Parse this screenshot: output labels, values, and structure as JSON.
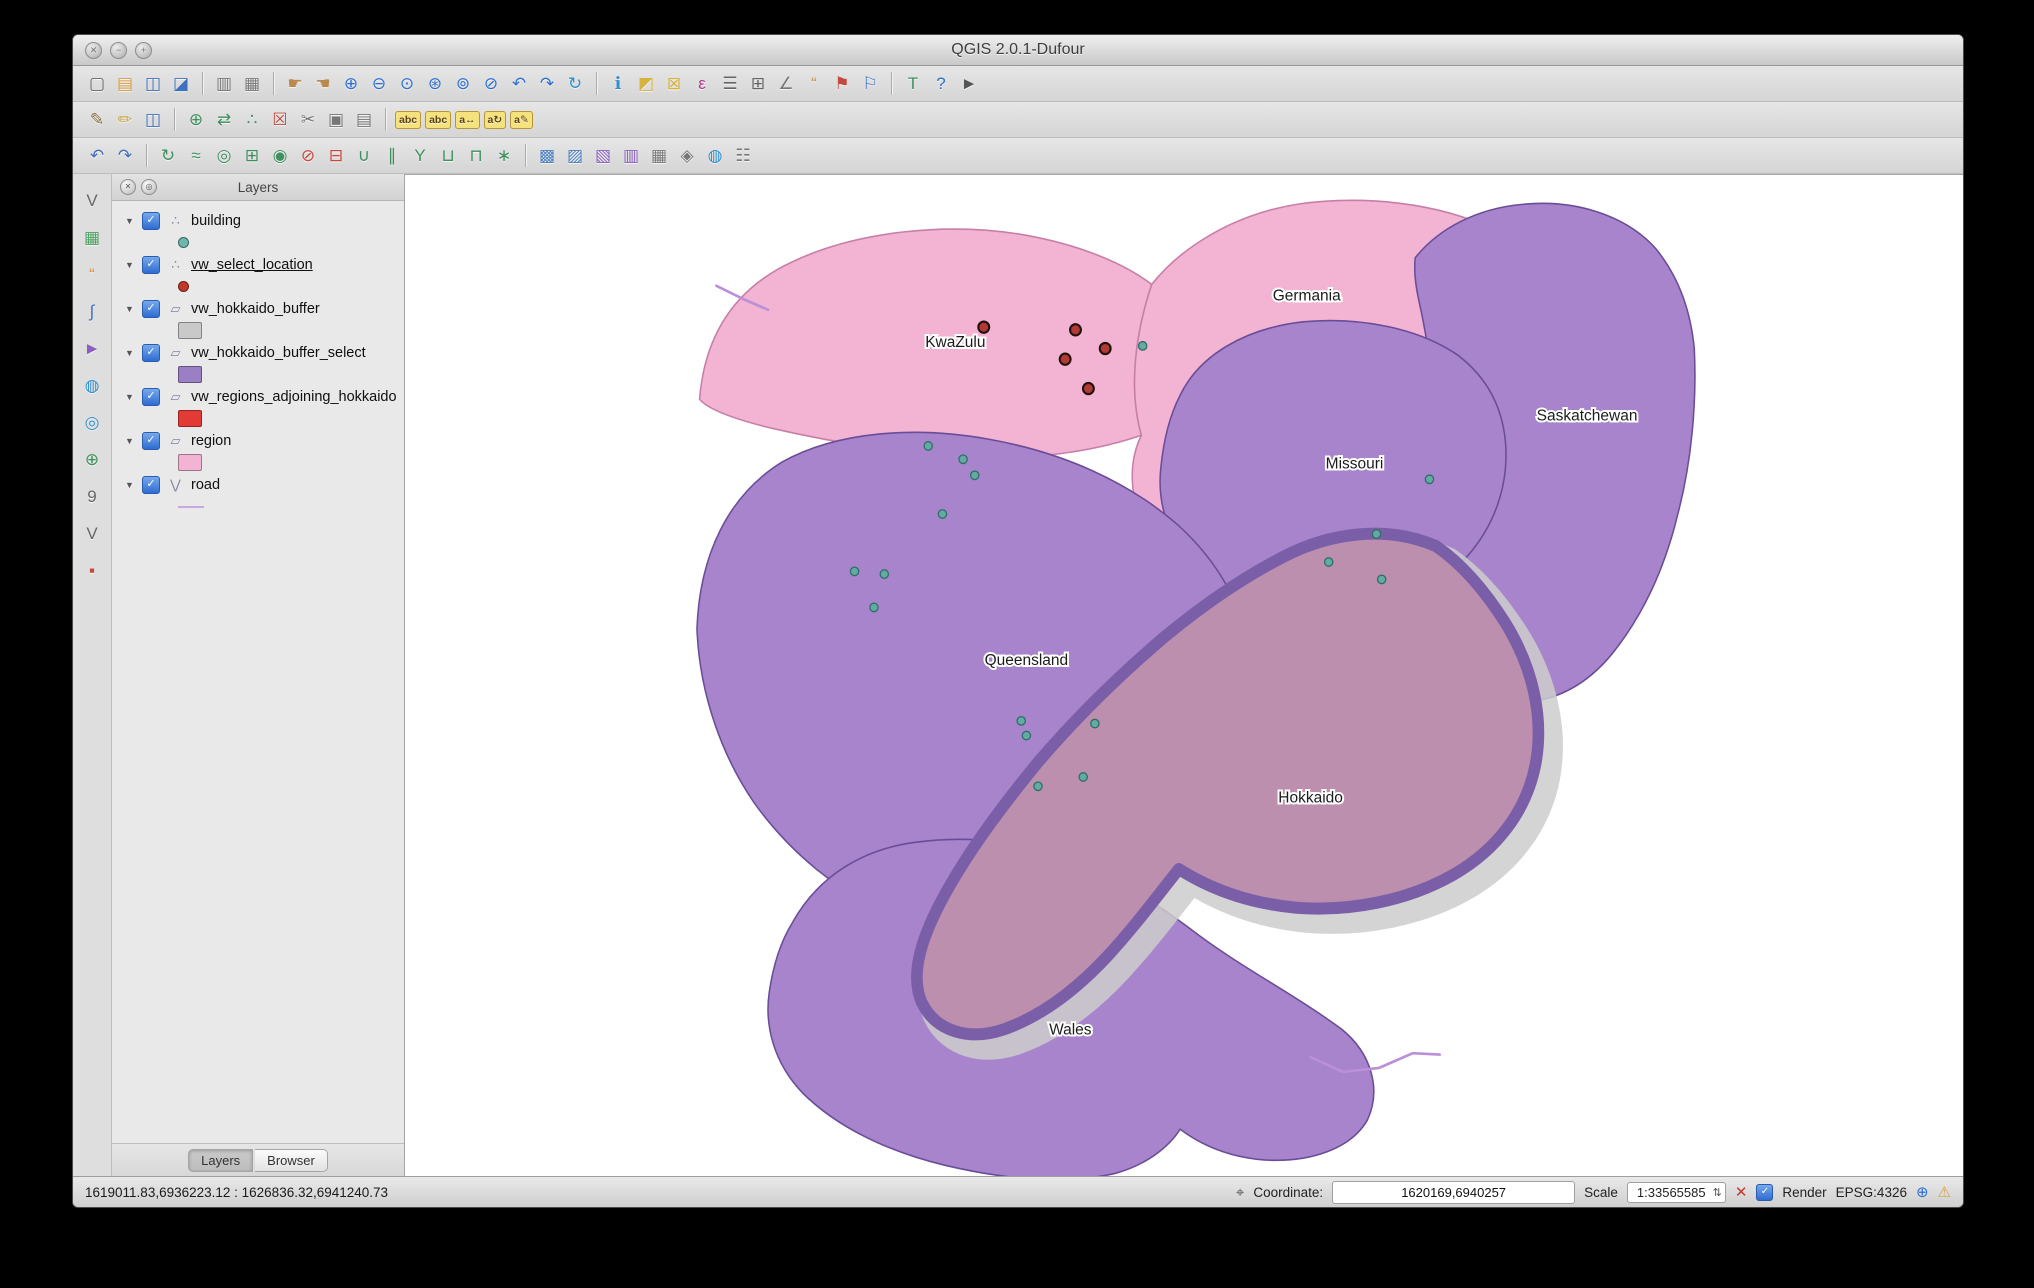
{
  "window": {
    "title": "QGIS 2.0.1-Dufour",
    "traffic": [
      "✕",
      "−",
      "+"
    ]
  },
  "glyphs": {
    "disclosure": "▼",
    "check": "✓",
    "combo_arrows": "⇅"
  },
  "toolbar_row1": [
    {
      "name": "new-project-icon",
      "glyph": "▢",
      "tint": "#666666"
    },
    {
      "name": "open-project-icon",
      "glyph": "▤",
      "tint": "#d79b3f"
    },
    {
      "name": "save-project-icon",
      "glyph": "◫",
      "tint": "#3f6fbf"
    },
    {
      "name": "save-project-as-icon",
      "glyph": "◪",
      "tint": "#3f6fbf"
    },
    {
      "sep": true
    },
    {
      "name": "new-print-composer-icon",
      "glyph": "▥",
      "tint": "#777777"
    },
    {
      "name": "composer-manager-icon",
      "glyph": "▦",
      "tint": "#777777"
    },
    {
      "sep": true
    },
    {
      "name": "pan-map-icon",
      "glyph": "☛",
      "tint": "#b98a4f"
    },
    {
      "name": "pan-to-selection-icon",
      "glyph": "☚",
      "tint": "#b98a4f"
    },
    {
      "name": "zoom-in-icon",
      "glyph": "⊕",
      "tint": "#2f6fd0"
    },
    {
      "name": "zoom-out-icon",
      "glyph": "⊖",
      "tint": "#2f6fd0"
    },
    {
      "name": "zoom-actual-icon",
      "glyph": "⊙",
      "tint": "#2f6fd0"
    },
    {
      "name": "zoom-full-icon",
      "glyph": "⊛",
      "tint": "#2f6fd0"
    },
    {
      "name": "zoom-to-selection-icon",
      "glyph": "⊚",
      "tint": "#2f6fd0"
    },
    {
      "name": "zoom-to-layer-icon",
      "glyph": "⊘",
      "tint": "#2f6fd0"
    },
    {
      "name": "zoom-last-icon",
      "glyph": "↶",
      "tint": "#2f6fd0"
    },
    {
      "name": "zoom-next-icon",
      "glyph": "↷",
      "tint": "#2f6fd0"
    },
    {
      "name": "refresh-icon",
      "glyph": "↻",
      "tint": "#2f8fd0"
    },
    {
      "sep": true
    },
    {
      "name": "identify-icon",
      "glyph": "ℹ",
      "tint": "#2f8fd0"
    },
    {
      "name": "select-features-icon",
      "glyph": "◩",
      "tint": "#d7b23f"
    },
    {
      "name": "deselect-features-icon",
      "glyph": "⊠",
      "tint": "#d7b23f"
    },
    {
      "name": "select-by-expression-icon",
      "glyph": "ε",
      "tint": "#b03a8f"
    },
    {
      "name": "attribute-table-icon",
      "glyph": "☰",
      "tint": "#666666"
    },
    {
      "name": "field-calculator-icon",
      "glyph": "⊞",
      "tint": "#666666"
    },
    {
      "name": "measure-icon",
      "glyph": "∠",
      "tint": "#777777"
    },
    {
      "name": "map-tips-icon",
      "glyph": "“",
      "tint": "#d78a3f"
    },
    {
      "name": "new-bookmark-icon",
      "glyph": "⚑",
      "tint": "#c24a3f"
    },
    {
      "name": "show-bookmarks-icon",
      "glyph": "⚐",
      "tint": "#3f6fbf"
    },
    {
      "sep": true
    },
    {
      "name": "text-annotation-icon",
      "glyph": "T",
      "tint": "#3f8f5f"
    },
    {
      "name": "help-icon",
      "glyph": "?",
      "tint": "#2f6fd0"
    },
    {
      "name": "whats-this-icon",
      "glyph": "►",
      "tint": "#555555"
    }
  ],
  "toolbar_row2": [
    {
      "name": "current-edits-icon",
      "glyph": "✎",
      "tint": "#8a6a3f"
    },
    {
      "name": "toggle-editing-icon",
      "glyph": "✏",
      "tint": "#c9a23f"
    },
    {
      "name": "save-layer-edits-icon",
      "glyph": "◫",
      "tint": "#3f6fbf"
    },
    {
      "sep": true
    },
    {
      "name": "add-feature-icon",
      "glyph": "⊕",
      "tint": "#3f8f5f"
    },
    {
      "name": "move-feature-icon",
      "glyph": "⇄",
      "tint": "#3f8f5f"
    },
    {
      "name": "node-tool-icon",
      "glyph": "∴",
      "tint": "#3f8f5f"
    },
    {
      "name": "delete-selected-icon",
      "glyph": "☒",
      "tint": "#c24a3f"
    },
    {
      "name": "cut-features-icon",
      "glyph": "✂",
      "tint": "#777777"
    },
    {
      "name": "copy-features-icon",
      "glyph": "▣",
      "tint": "#777777"
    },
    {
      "name": "paste-features-icon",
      "glyph": "▤",
      "tint": "#777777"
    },
    {
      "sep": true
    },
    {
      "name": "labeling-icon",
      "glyph": "abc",
      "chip": true
    },
    {
      "name": "label-selected-icon",
      "glyph": "abc",
      "chip": true
    },
    {
      "name": "label-move-icon",
      "glyph": "a↔",
      "chip": true
    },
    {
      "name": "label-rotate-icon",
      "glyph": "a↻",
      "chip": true
    },
    {
      "name": "label-properties-icon",
      "glyph": "a✎",
      "chip": true
    }
  ],
  "toolbar_row3": [
    {
      "name": "undo-icon",
      "glyph": "↶",
      "tint": "#3f6fbf"
    },
    {
      "name": "redo-icon",
      "glyph": "↷",
      "tint": "#3f6fbf"
    },
    {
      "sep": true
    },
    {
      "name": "rotate-feature-icon",
      "glyph": "↻",
      "tint": "#3f8f5f"
    },
    {
      "name": "simplify-feature-icon",
      "glyph": "≈",
      "tint": "#3f8f5f"
    },
    {
      "name": "add-ring-icon",
      "glyph": "◎",
      "tint": "#3f8f5f"
    },
    {
      "name": "add-part-icon",
      "glyph": "⊞",
      "tint": "#3f8f5f"
    },
    {
      "name": "fill-ring-icon",
      "glyph": "◉",
      "tint": "#3f8f5f"
    },
    {
      "name": "delete-ring-icon",
      "glyph": "⊘",
      "tint": "#c24a3f"
    },
    {
      "name": "delete-part-icon",
      "glyph": "⊟",
      "tint": "#c24a3f"
    },
    {
      "name": "reshape-features-icon",
      "glyph": "∪",
      "tint": "#3f8f5f"
    },
    {
      "name": "offset-curve-icon",
      "glyph": "∥",
      "tint": "#3f8f5f"
    },
    {
      "name": "split-features-icon",
      "glyph": "Y",
      "tint": "#3f8f5f"
    },
    {
      "name": "merge-features-icon",
      "glyph": "⊔",
      "tint": "#3f8f5f"
    },
    {
      "name": "merge-attributes-icon",
      "glyph": "⊓",
      "tint": "#3f8f5f"
    },
    {
      "name": "rotate-point-symbols-icon",
      "glyph": "∗",
      "tint": "#3f8f5f"
    },
    {
      "sep": true
    },
    {
      "name": "select-by-location-icon",
      "glyph": "▩",
      "tint": "#4a7fbf"
    },
    {
      "name": "random-selection-icon",
      "glyph": "▨",
      "tint": "#4a7fbf"
    },
    {
      "name": "spatial-index-icon",
      "glyph": "▧",
      "tint": "#8a5fbf"
    },
    {
      "name": "vector-grid-icon",
      "glyph": "▥",
      "tint": "#8a5fbf"
    },
    {
      "name": "raster-tools-icon",
      "glyph": "▦",
      "tint": "#777777"
    },
    {
      "name": "geometry-tools-icon",
      "glyph": "◈",
      "tint": "#777777"
    },
    {
      "name": "web-tools-icon",
      "glyph": "◍",
      "tint": "#2f8fd0"
    },
    {
      "name": "database-tools-icon",
      "glyph": "☷",
      "tint": "#777777"
    }
  ],
  "left_toolbar": [
    {
      "name": "vector-layer-tool-icon",
      "glyph": "V",
      "tint": "#666666"
    },
    {
      "name": "raster-georeferencer-icon",
      "glyph": "▦",
      "tint": "#4a9f5f"
    },
    {
      "name": "annotation-bubbles-icon",
      "glyph": "“",
      "tint": "#d78a3f"
    },
    {
      "name": "interpolation-icon",
      "glyph": "∫",
      "tint": "#3f6fbf"
    },
    {
      "name": "spatial-query-icon",
      "glyph": "►",
      "tint": "#8a5fbf"
    },
    {
      "name": "web-globe-icon",
      "glyph": "◍",
      "tint": "#2f8fd0"
    },
    {
      "name": "metasearch-globe-icon",
      "glyph": "◎",
      "tint": "#2f8fd0"
    },
    {
      "name": "gps-tools-icon",
      "glyph": "⊕",
      "tint": "#3f8f5f"
    },
    {
      "name": "coordinate-capture-icon",
      "glyph": "9",
      "tint": "#666666"
    },
    {
      "name": "topology-checker-icon",
      "glyph": "V",
      "tint": "#666666"
    },
    {
      "name": "plugin-builder-icon",
      "glyph": "▪",
      "tint": "#c24a3f"
    }
  ],
  "layers_panel": {
    "title": "Layers",
    "header_buttons": [
      {
        "name": "panel-close-icon",
        "glyph": "✕"
      },
      {
        "name": "panel-float-icon",
        "glyph": "◎"
      }
    ],
    "items": [
      {
        "name": "building",
        "label": "building",
        "type_glyph": "∴",
        "swatch": {
          "kind": "dot",
          "color": "#6fb7ae"
        }
      },
      {
        "name": "vw_select_location",
        "label": "vw_select_location",
        "underline": true,
        "type_glyph": "∴",
        "swatch": {
          "kind": "dot",
          "color": "#c0392b"
        }
      },
      {
        "name": "vw_hokkaido_buffer",
        "label": "vw_hokkaido_buffer",
        "type_glyph": "▱",
        "swatch": {
          "kind": "rect",
          "color": "#c9c9c9"
        }
      },
      {
        "name": "vw_hokkaido_buffer_select",
        "label": "vw_hokkaido_buffer_select",
        "type_glyph": "▱",
        "swatch": {
          "kind": "rect",
          "color": "#9b7fc4"
        }
      },
      {
        "name": "vw_regions_adjoining_hokkaido",
        "label": "vw_regions_adjoining_hokkaido",
        "type_glyph": "▱",
        "swatch": {
          "kind": "rect",
          "color": "#e23b35"
        }
      },
      {
        "name": "region",
        "label": "region",
        "type_glyph": "▱",
        "swatch": {
          "kind": "rect",
          "color": "#f3b3d2"
        }
      },
      {
        "name": "road",
        "label": "road",
        "type_glyph": "⋁",
        "swatch": {
          "kind": "line",
          "color": "#c9a7e0"
        }
      }
    ],
    "tabs": [
      {
        "label": "Layers",
        "active": true
      },
      {
        "label": "Browser",
        "active": false
      }
    ]
  },
  "map": {
    "labels": {
      "kwazulu": "KwaZulu",
      "germania": "Germania",
      "saskatchewan": "Saskatchewan",
      "missouri": "Missouri",
      "queensland": "Queensland",
      "hokkaido": "Hokkaido",
      "wales": "Wales"
    },
    "colors": {
      "region_pink": "#f3b3d2",
      "region_purple": "#a784cb",
      "hokkaido_mauve": "#bd8fae",
      "buffer_outline": "#7a5fa8",
      "buffer_gray": "#cdcdcd",
      "point_teal": "#63aaa2",
      "point_red": "#b03a34",
      "canvas": "#ffffff"
    }
  },
  "status_bar": {
    "extents": "1619011.83,6936223.12 : 1626836.32,6941240.73",
    "coordinate_label": "Coordinate:",
    "coordinate_value": "1620169,6940257",
    "scale_label": "Scale",
    "scale_value": "1:33565585",
    "render_label": "Render",
    "epsg": "EPSG:4326",
    "icons": {
      "mouse_position": "⌖",
      "stop_render": "✕",
      "crs": "⊕",
      "messages": "⚠"
    }
  }
}
